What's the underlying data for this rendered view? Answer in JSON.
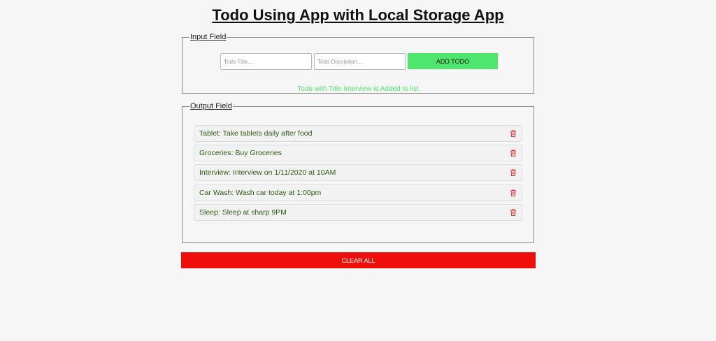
{
  "page": {
    "title": "Todo Using App with Local Storage App"
  },
  "input_section": {
    "legend": "Input Field",
    "title_placeholder": "Todo Title....",
    "description_placeholder": "Todo Discription....",
    "add_label": "ADD TODO",
    "status_message": "Todo with Title Interview is Added to list"
  },
  "output_section": {
    "legend": "Output Field",
    "todos": [
      {
        "text": "Tablet: Take tablets daily after food",
        "icon": "trash-icon"
      },
      {
        "text": "Groceries: Buy Groceries",
        "icon": "trash-icon"
      },
      {
        "text": "Interview: Interview on 1/11/2020 at 10AM",
        "icon": "trash-icon"
      },
      {
        "text": "Car Wash: Wash car today at 1:00pm",
        "icon": "trash-icon"
      },
      {
        "text": "Sleep: Sleep at sharp 9PM",
        "icon": "trash-icon"
      }
    ]
  },
  "clear_all_label": "CLEAR ALL",
  "colors": {
    "add_button": "#4ee66f",
    "status_text": "#4ee66f",
    "todo_text": "#2e5a12",
    "delete_icon": "#e03030",
    "clear_button": "#ef0f0a"
  }
}
